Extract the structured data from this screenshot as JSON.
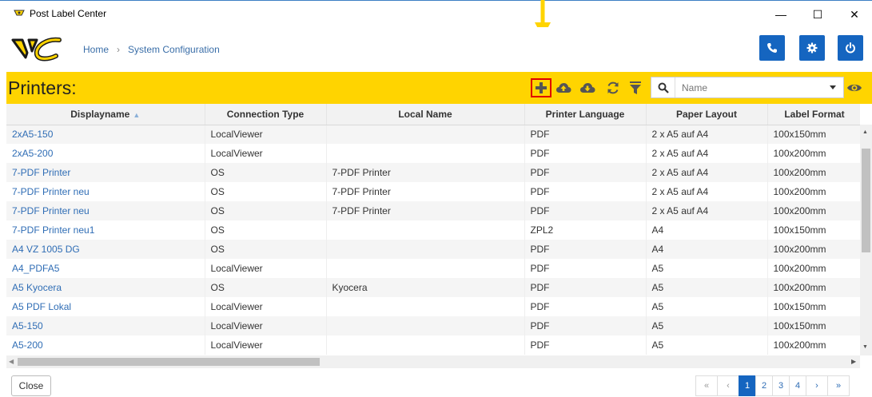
{
  "window": {
    "title": "Post Label Center",
    "min_symbol": "—",
    "max_symbol": "☐",
    "close_symbol": "✕"
  },
  "breadcrumb": {
    "home": "Home",
    "separator": "›",
    "current": "System Configuration"
  },
  "header_buttons": {
    "phone_icon": "phone-icon",
    "settings_icon": "gear-icon",
    "power_icon": "power-icon"
  },
  "toolbar": {
    "title": "Printers:",
    "search_placeholder": "Name",
    "icons": [
      "plus-icon",
      "cloud-upload-icon",
      "cloud-download-icon",
      "refresh-icon",
      "filter-icon",
      "eye-icon"
    ]
  },
  "colors": {
    "brand_yellow": "#ffd400",
    "brand_blue": "#1565c0",
    "link_blue": "#2f6db5",
    "highlight_red": "#e00000"
  },
  "table": {
    "columns": [
      "Displayname",
      "Connection Type",
      "Local Name",
      "Printer Language",
      "Paper Layout",
      "Label Format"
    ],
    "sort_indicator": "▲",
    "rows": [
      [
        "2xA5-150",
        "LocalViewer",
        "",
        "PDF",
        "2 x A5 auf A4",
        "100x150mm"
      ],
      [
        "2xA5-200",
        "LocalViewer",
        "",
        "PDF",
        "2 x A5 auf A4",
        "100x200mm"
      ],
      [
        "7-PDF Printer",
        "OS",
        "7-PDF Printer",
        "PDF",
        "2 x A5 auf A4",
        "100x200mm"
      ],
      [
        "7-PDF Printer neu",
        "OS",
        "7-PDF Printer",
        "PDF",
        "2 x A5 auf A4",
        "100x200mm"
      ],
      [
        "7-PDF Printer neu",
        "OS",
        "7-PDF Printer",
        "PDF",
        "2 x A5 auf A4",
        "100x200mm"
      ],
      [
        "7-PDF Printer neu1",
        "OS",
        "",
        "ZPL2",
        "A4",
        "100x150mm"
      ],
      [
        "A4 VZ 1005 DG",
        "OS",
        "",
        "PDF",
        "A4",
        "100x200mm"
      ],
      [
        "A4_PDFA5",
        "LocalViewer",
        "",
        "PDF",
        "A5",
        "100x200mm"
      ],
      [
        "A5 Kyocera",
        "OS",
        "Kyocera",
        "PDF",
        "A5",
        "100x200mm"
      ],
      [
        "A5 PDF Lokal",
        "LocalViewer",
        "",
        "PDF",
        "A5",
        "100x150mm"
      ],
      [
        "A5-150",
        "LocalViewer",
        "",
        "PDF",
        "A5",
        "100x150mm"
      ],
      [
        "A5-200",
        "LocalViewer",
        "",
        "PDF",
        "A5",
        "100x200mm"
      ]
    ]
  },
  "footer": {
    "close_label": "Close",
    "pager": [
      "«",
      "‹",
      "1",
      "2",
      "3",
      "4",
      "›",
      "»"
    ],
    "active_page": "1"
  }
}
